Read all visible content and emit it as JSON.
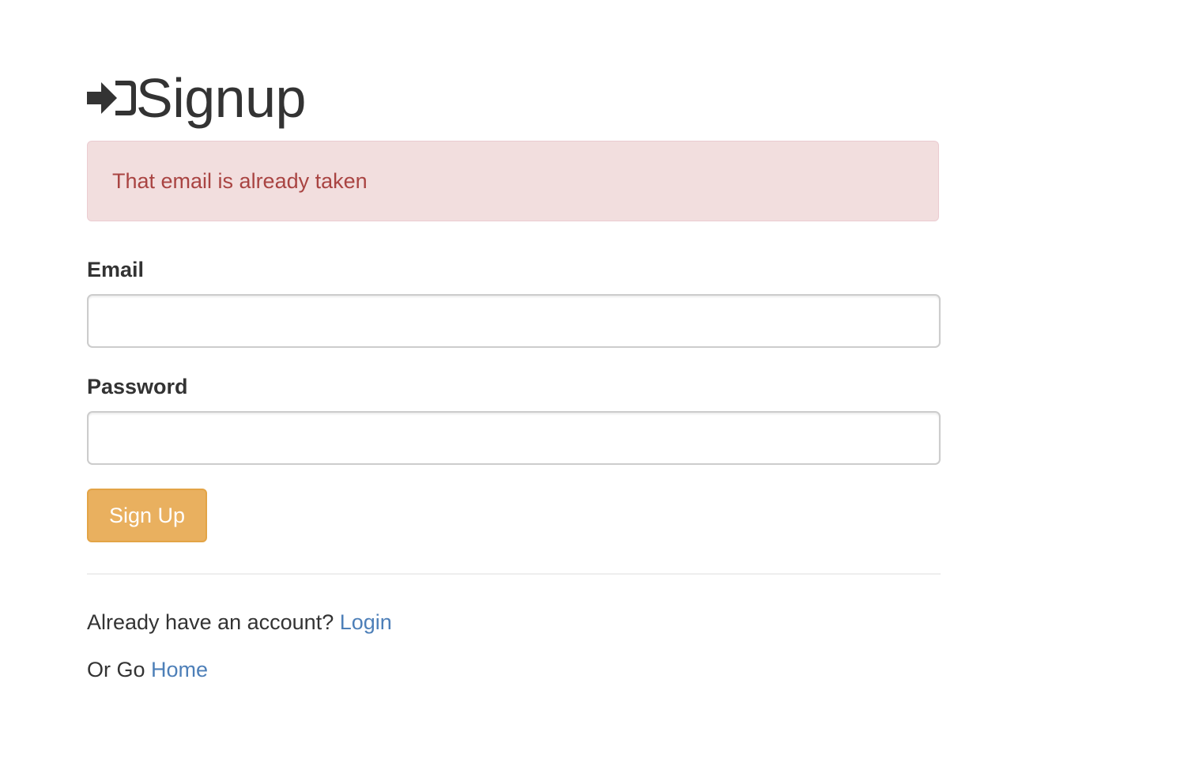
{
  "header": {
    "icon": "sign-in-icon",
    "title": "Signup"
  },
  "alert": {
    "message": "That email is already taken",
    "color": "#a94442",
    "background": "#f2dede"
  },
  "form": {
    "email": {
      "label": "Email",
      "value": "",
      "placeholder": ""
    },
    "password": {
      "label": "Password",
      "value": "",
      "placeholder": ""
    },
    "submit_label": "Sign Up",
    "submit_color": "#e9b05f"
  },
  "footer": {
    "login_prompt": "Already have an account? ",
    "login_link": "Login",
    "home_prompt": "Or Go ",
    "home_link": "Home",
    "link_color": "#4d7fb8"
  }
}
